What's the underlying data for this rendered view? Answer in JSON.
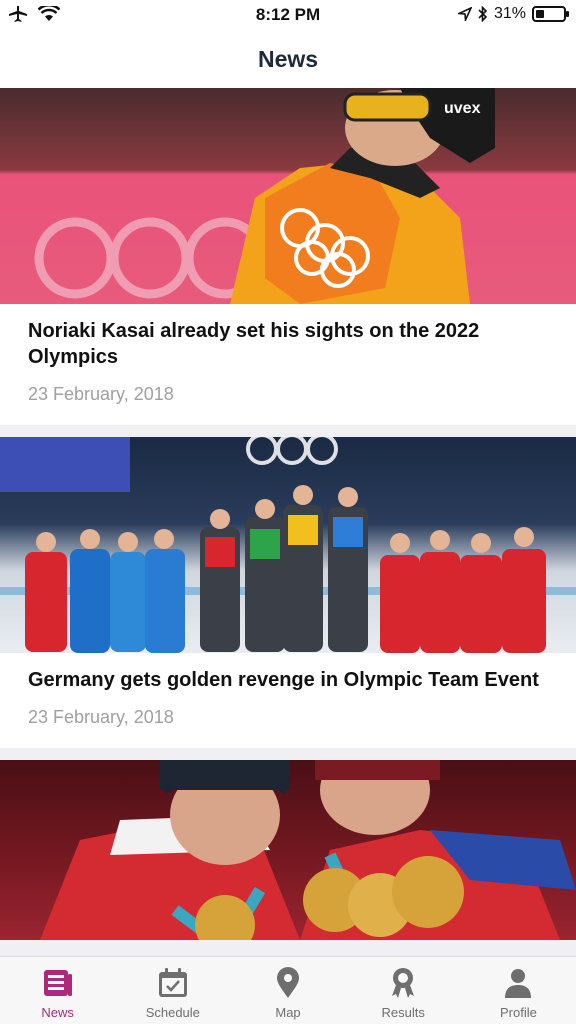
{
  "status": {
    "time": "8:12 PM",
    "battery": "31%",
    "battery_level": 0.31
  },
  "nav": {
    "title": "News"
  },
  "articles": [
    {
      "title": "Noriaki Kasai already set his sights on the 2022 Olympics",
      "date": "23 February, 2018",
      "image_text": "uvex"
    },
    {
      "title": "Germany gets golden revenge in Olympic Team Event",
      "date": "23 February, 2018"
    },
    {
      "title": "",
      "date": ""
    }
  ],
  "tabs": [
    {
      "label": "News",
      "icon": "news-icon",
      "active": true
    },
    {
      "label": "Schedule",
      "icon": "calendar-icon",
      "active": false
    },
    {
      "label": "Map",
      "icon": "map-pin-icon",
      "active": false
    },
    {
      "label": "Results",
      "icon": "medal-icon",
      "active": false
    },
    {
      "label": "Profile",
      "icon": "person-icon",
      "active": false
    }
  ],
  "colors": {
    "accent": "#b0287a",
    "inactive": "#6e6e6e",
    "title": "#1d2a3a"
  }
}
